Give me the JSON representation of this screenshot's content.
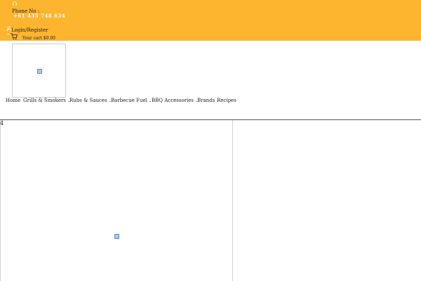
{
  "header": {
    "phone_label": "Phone No :",
    "phone_number": "+61 435 748 634",
    "login_label": "Login/Register",
    "cart_label": "Your cart $0.00",
    "bg_color": "#fdb52f",
    "icons": [
      "headset-icon",
      "user-icon",
      "cart-icon"
    ]
  },
  "logo": {
    "state": "broken-image"
  },
  "nav": {
    "items": [
      {
        "label": "Home"
      },
      {
        "label": "Grills & Smokers"
      },
      {
        "label": "Rubs & Sauces"
      },
      {
        "label": "Barbecue Fuel"
      },
      {
        "label": "BBQ Accessories"
      },
      {
        "label": "Brands"
      },
      {
        "label": "Recipes"
      }
    ]
  },
  "content": {
    "counter": "4",
    "hero_image": "broken-image"
  }
}
